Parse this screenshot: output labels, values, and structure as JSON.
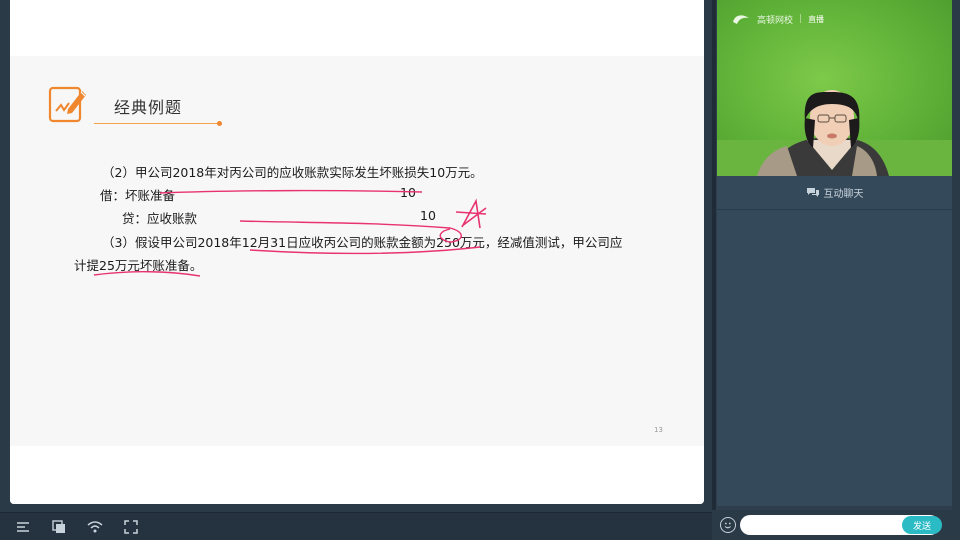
{
  "slide": {
    "section_title": "经典例题",
    "line1": "（2）甲公司2018年对丙公司的应收账款实际发生坏账损失10万元。",
    "debit_label": "借：坏账准备",
    "debit_amount": "10",
    "credit_label": "贷：应收账款",
    "credit_amount": "10",
    "line3a": "（3）假设甲公司2018年12月31日应收丙公司的账款金额为250万元，经减值测试，甲公司应",
    "line3b": "计提25万元坏账准备。",
    "page_number": "13"
  },
  "colors": {
    "accent_orange": "#f0862e",
    "annotation_pink": "#e8336f",
    "send_button": "#2bbbc4"
  },
  "toolbar": {
    "icons": [
      "list-icon",
      "copy-icon",
      "wifi-icon",
      "fullscreen-icon"
    ]
  },
  "side": {
    "logo_text": "高顿网校",
    "logo_badge": "直播",
    "chat_title": "互动聊天",
    "input_value": "",
    "send_label": "发送"
  }
}
